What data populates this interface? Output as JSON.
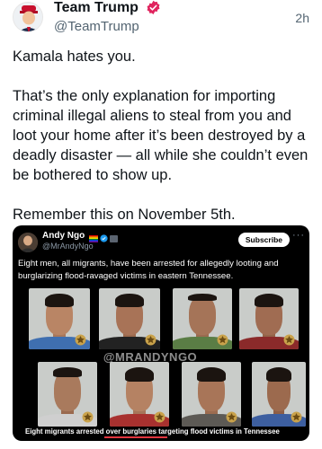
{
  "tweet": {
    "display_name": "Team Trump",
    "handle": "@TeamTrump",
    "timestamp": "2h",
    "paragraphs": [
      "Kamala hates you.",
      "That’s the only explanation for importing criminal illegal aliens to steal from you and loot your home after it’s been destroyed by a deadly disaster — all while she couldn’t even be bothered to show up.",
      "Remember this on November 5th."
    ],
    "verified_color": "#e0245e"
  },
  "quote": {
    "display_name": "Andy Ngo",
    "handle": "@MrAndyNgo",
    "subscribe_label": "Subscribe",
    "more_label": "···",
    "text": "Eight men, all migrants, have been arrested for allegedly looting and burglarizing flood-ravaged victims in eastern Tennessee.",
    "watermark": "@MRANDYNGO",
    "caption": "Eight migrants arrested over burglaries targeting flood victims in Tennessee",
    "accent_color": "#e1353e"
  }
}
